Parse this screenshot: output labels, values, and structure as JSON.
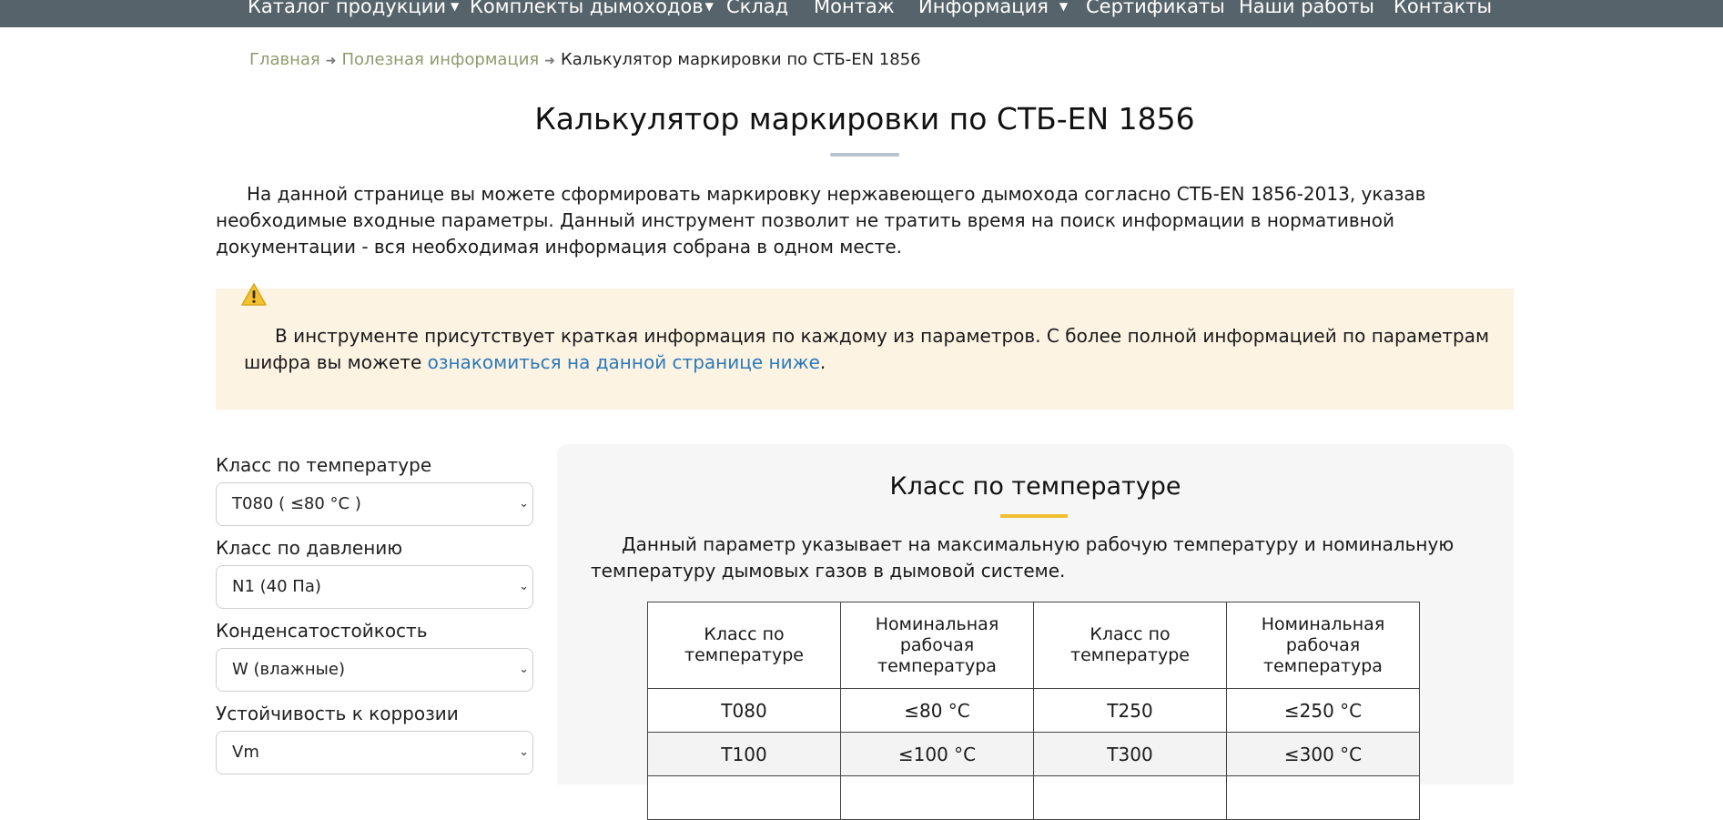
{
  "nav": {
    "items": [
      {
        "label": "Каталог продукции",
        "dropdown": true
      },
      {
        "label": "Комплекты дымоходов",
        "dropdown": true
      },
      {
        "label": "Склад",
        "dropdown": false
      },
      {
        "label": "Монтаж",
        "dropdown": false
      },
      {
        "label": "Информация",
        "dropdown": true
      },
      {
        "label": "Сертификаты",
        "dropdown": false
      },
      {
        "label": "Наши работы",
        "dropdown": false
      },
      {
        "label": "Контакты",
        "dropdown": false
      }
    ]
  },
  "breadcrumb": {
    "home": "Главная",
    "section": "Полезная информация",
    "current": "Калькулятор маркировки по СТБ-EN 1856"
  },
  "page": {
    "title": "Калькулятор маркировки по СТБ-EN 1856",
    "intro": "На данной странице вы можете сформировать маркировку нержавеющего дымохода согласно СТБ-EN 1856-2013, указав необходимые входные параметры. Данный инструмент позволит не тратить время на поиск информации в нормативной документации - вся необходимая информация собрана в одном месте."
  },
  "notice": {
    "text": "В инструменте присутствует краткая информация по каждому из параметров. С более полной информацией по параметрам шифра вы можете ",
    "link": "ознакомиться на данной странице ниже",
    "end": "."
  },
  "form": {
    "fields": [
      {
        "label": "Класс по температуре",
        "value": "Т080 ( ≤80 °C )"
      },
      {
        "label": "Класс по давлению",
        "value": "N1 (40 Па)"
      },
      {
        "label": "Конденсатостойкость",
        "value": "W (влажные)"
      },
      {
        "label": "Устойчивость к коррозии",
        "value": "Vm"
      }
    ]
  },
  "info": {
    "title": "Класс по температуре",
    "text": "Данный параметр указывает на максимальную рабочую температуру и номинальную температуру дымовых газов в дымовой системе.",
    "table": {
      "headers": [
        "Класс по температуре",
        "Номинальная рабочая температура",
        "Класс по температуре",
        "Номинальная рабочая температура"
      ],
      "rows": [
        [
          "T080",
          "≤80 °C",
          "T250",
          "≤250 °C"
        ],
        [
          "T100",
          "≤100 °C",
          "T300",
          "≤300 °C"
        ]
      ]
    }
  },
  "colors": {
    "nav_bg": "#56636b",
    "breadcrumb_link": "#8f9a6e",
    "notice_bg": "#fcf3e3",
    "link": "#2b79b8",
    "accent_yellow": "#f0c030"
  }
}
